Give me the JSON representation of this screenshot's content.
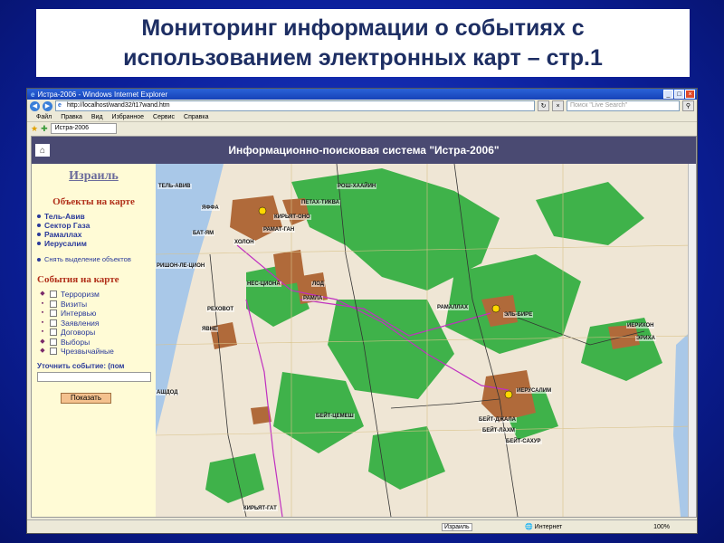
{
  "slide": {
    "title": "Мониторинг информации о событиях с\nиспользованием электронных карт – стр.1"
  },
  "browser": {
    "window_title": "Истра-2006 - Windows Internet Explorer",
    "url": "http://localhost/wand32/t17wand.htm",
    "search_placeholder": "Поиск \"Live Search\"",
    "menu": [
      "Файл",
      "Правка",
      "Вид",
      "Избранное",
      "Сервис",
      "Справка"
    ],
    "tab_title": "Истра-2006",
    "status_zone": "Интернет",
    "status_zoom": "100%",
    "status_israel": "Израиль"
  },
  "app": {
    "banner_title": "Информационно-поисковая система \"Истра-2006\"",
    "sidebar": {
      "country": "Израиль",
      "objects_title": "Объекты на карте",
      "objects": [
        "Тель-Авив",
        "Сектор Газа",
        "Рамаллах",
        "Иерусалим"
      ],
      "clear_selection": "Снять выделение объектов",
      "events_title": "События на карте",
      "events": [
        "Терроризм",
        "Визиты",
        "Интервью",
        "Заявления",
        "Договоры",
        "Выборы",
        "Чрезвычайные"
      ],
      "refine_label": "Уточнить событие: (пом",
      "show_button": "Показать"
    },
    "map": {
      "labels": [
        "ТЕЛЬ-АВИВ",
        "ЯФФА",
        "БАТ-ЯМ",
        "ХОЛОН",
        "РАМАТ-ГАН",
        "КИРЬЯТ-ОНО",
        "ПЕТАХ-ТИКВА",
        "РОШ-ХААЙИН",
        "РИШОН-ЛЕ-ЦИОН",
        "РЕХОВОТ",
        "ЯВНЕ",
        "РАМЛА",
        "ЛОД",
        "НЕС-ЦИОНА",
        "РАМАЛЛАХ",
        "ЭЛЬ-БИРЕ",
        "ИЕРУСАЛИМ",
        "БЕЙТ-ЦЕМЕШ",
        "БЕЙТ-ДЖАЛА",
        "БЕЙТ-ЛАХМ",
        "БЕЙТ-САХУР",
        "ИЕРИХОН",
        "ЭРИХА",
        "КИРЬЯТ-ГАТ",
        "АШДОД"
      ]
    }
  },
  "colors": {
    "background": "#0b1f9a",
    "banner": "#4a4a72",
    "sidebar": "#fffbd6",
    "forest": "#3fb24a",
    "city": "#b06a3a",
    "sea": "#a9c8e8"
  }
}
